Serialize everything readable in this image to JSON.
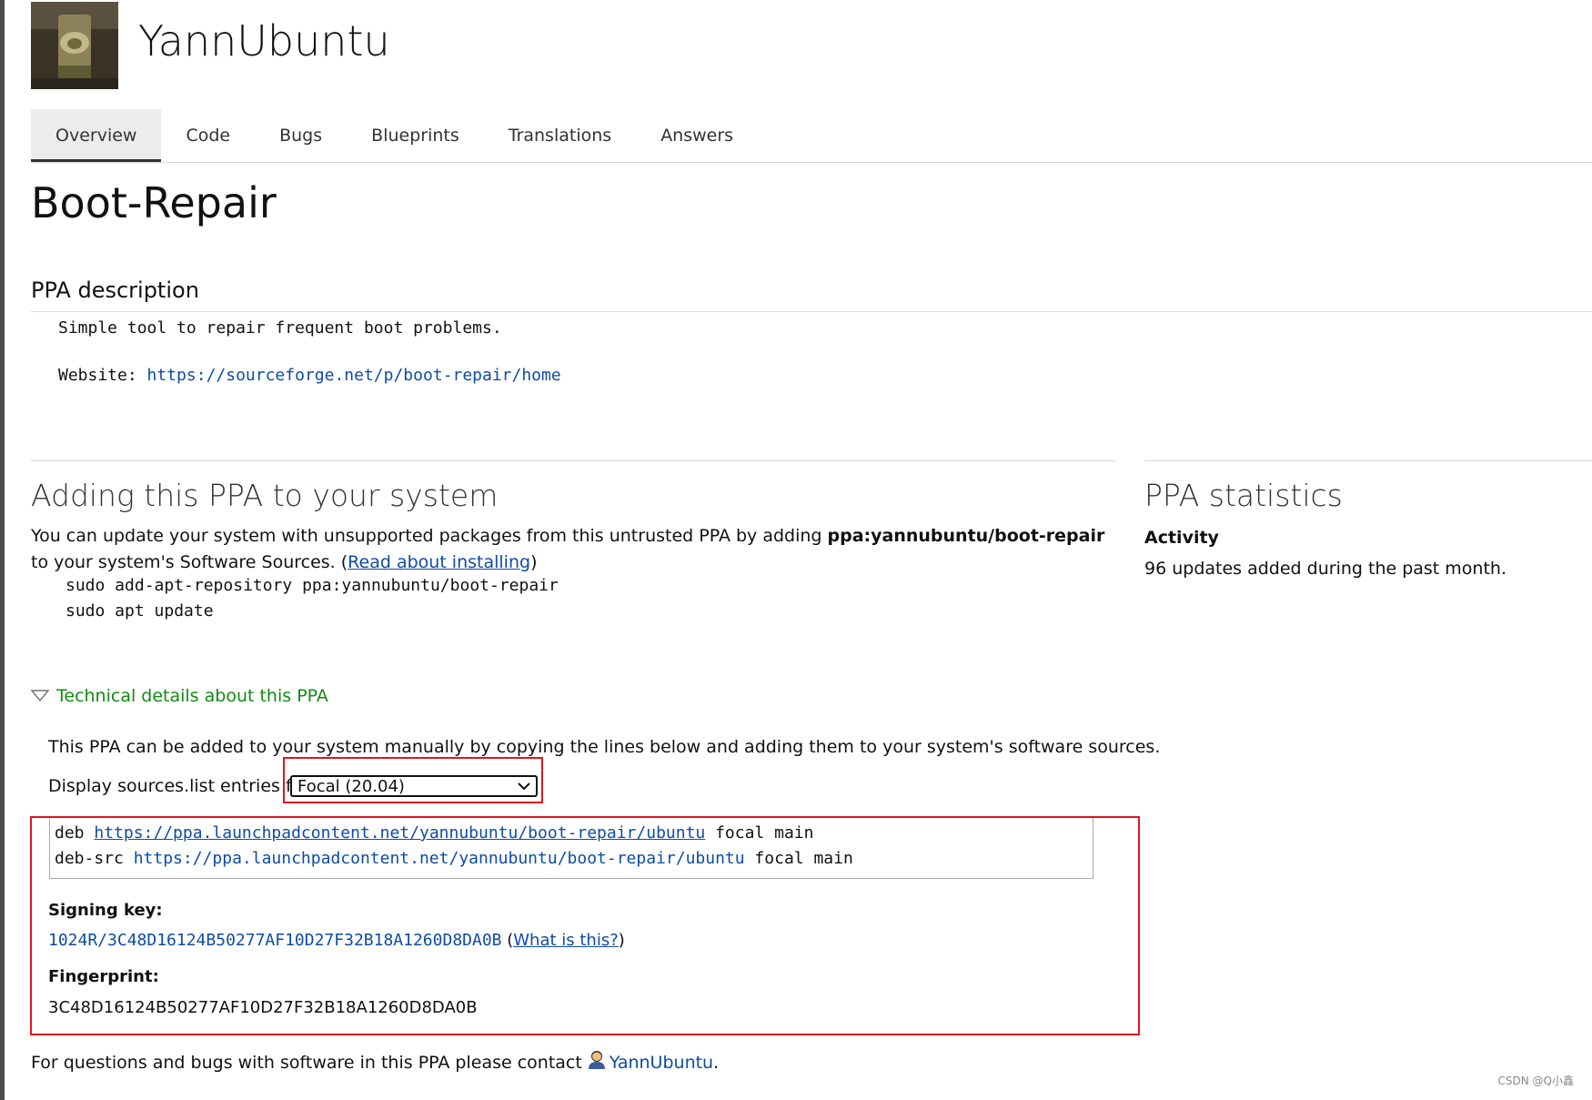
{
  "header": {
    "brand": "YannUbuntu",
    "logo_icon": "profile-photo"
  },
  "tabs": [
    {
      "label": "Overview",
      "active": true
    },
    {
      "label": "Code",
      "active": false
    },
    {
      "label": "Bugs",
      "active": false
    },
    {
      "label": "Blueprints",
      "active": false
    },
    {
      "label": "Translations",
      "active": false
    },
    {
      "label": "Answers",
      "active": false
    }
  ],
  "page_title": "Boot-Repair",
  "description": {
    "heading": "PPA description",
    "line1": "Simple tool to repair frequent boot problems.",
    "website_label": "Website: ",
    "website_url": "https://sourceforge.net/p/boot-repair/home"
  },
  "adding": {
    "heading": "Adding this PPA to your system",
    "text_before": "You can update your system with unsupported packages from this untrusted PPA by adding ",
    "ppa_name": "ppa:yannubuntu/boot-repair",
    "text_after": " to your system's Software Sources. (",
    "read_link": "Read about installing",
    "text_close": ")",
    "cmd1": "sudo add-apt-repository ppa:yannubuntu/boot-repair",
    "cmd2": "sudo apt update"
  },
  "technical": {
    "toggle_label": "Technical details about this PPA",
    "toggle_icon": "triangle-down-icon",
    "intro": "This PPA can be added to your system manually by copying the lines below and adding them to your system's software sources.",
    "display_label": "Display sources.list entries for:",
    "selected_series": "Focal (20.04)",
    "deb_prefix": "deb ",
    "deb_url": "https://ppa.launchpadcontent.net/yannubuntu/boot-repair/ubuntu",
    "deb_suffix": " focal main",
    "debsrc_prefix": "deb-src ",
    "debsrc_url": "https://ppa.launchpadcontent.net/yannubuntu/boot-repair/ubuntu",
    "debsrc_suffix": " focal main",
    "signing_label": "Signing key:",
    "signing_key": "1024R/3C48D16124B50277AF10D27F32B18A1260D8DA0B",
    "what_open": " (",
    "what_link": "What is this?",
    "what_close": ")",
    "fingerprint_label": "Fingerprint:",
    "fingerprint": "3C48D16124B50277AF10D27F32B18A1260D8DA0B"
  },
  "stats": {
    "heading": "PPA statistics",
    "activity_label": "Activity",
    "updates": "96 updates added during the past month."
  },
  "footer": {
    "contact_text": "For questions and bugs with software in this PPA please contact",
    "contact_icon": "person-icon",
    "contact_link": "YannUbuntu",
    "period": "."
  },
  "watermark": "CSDN @Q小鑫",
  "colors": {
    "link": "#0e4ba6",
    "tech_green": "#138a13",
    "highlight_red": "#e0141e"
  }
}
